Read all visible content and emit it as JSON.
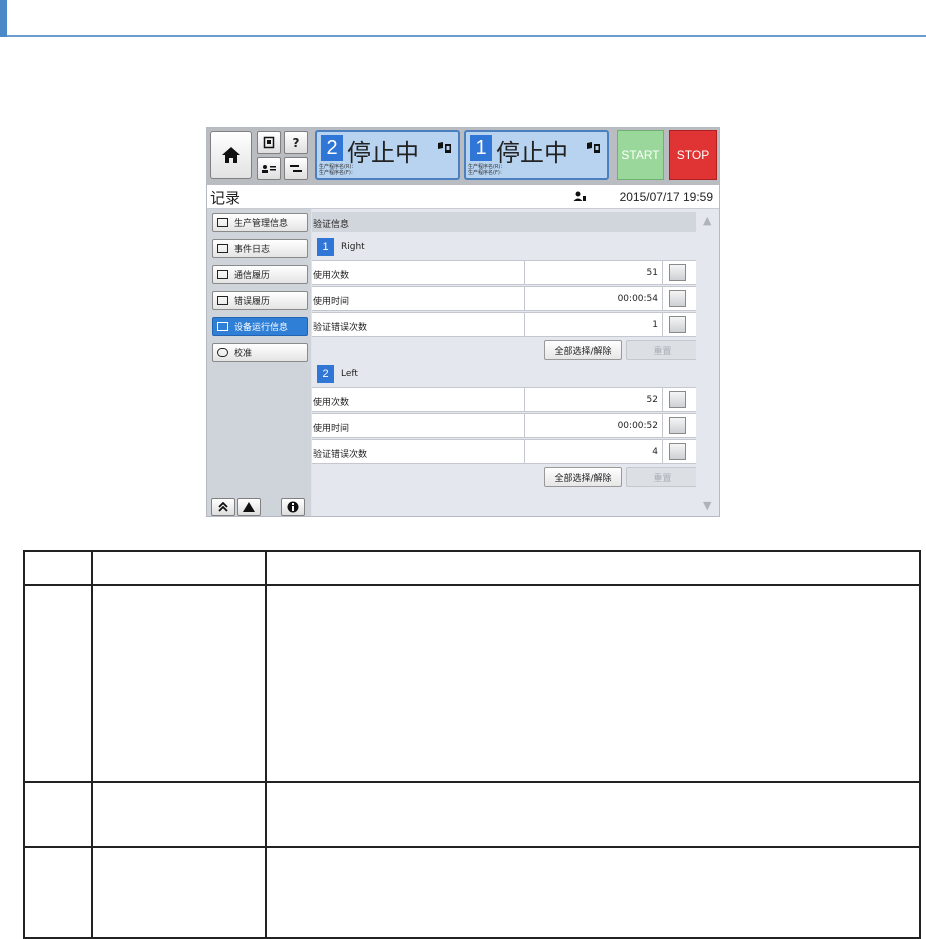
{
  "topbar": {
    "status_right": {
      "number": "2",
      "text": "停止中",
      "sub1": "生产程序名(R)：",
      "sub2": "生产程序名(F)："
    },
    "status_left": {
      "number": "1",
      "text": "停止中",
      "sub1": "生产程序名(R)：",
      "sub2": "生产程序名(F)："
    },
    "start_label": "START",
    "stop_label": "STOP",
    "help_label": "?"
  },
  "titlebar": {
    "title": "记录",
    "datetime": "2015/07/17 19:59"
  },
  "sidebar": {
    "items": [
      {
        "label": "生产管理信息",
        "active": false
      },
      {
        "label": "事件日志",
        "active": false
      },
      {
        "label": "通信履历",
        "active": false
      },
      {
        "label": "错误履历",
        "active": false
      },
      {
        "label": "设备运行信息",
        "active": true
      },
      {
        "label": "校准",
        "active": false
      }
    ]
  },
  "content": {
    "section_title": "验证信息",
    "groups": [
      {
        "number": "1",
        "name": "Right",
        "rows": [
          {
            "label": "使用次数",
            "value": "51"
          },
          {
            "label": "使用时间",
            "value": "00:00:54"
          },
          {
            "label": "验证错误次数",
            "value": "1"
          }
        ],
        "select_all_label": "全部选择/解除",
        "reset_label": "重置"
      },
      {
        "number": "2",
        "name": "Left",
        "rows": [
          {
            "label": "使用次数",
            "value": "52"
          },
          {
            "label": "使用时间",
            "value": "00:00:52"
          },
          {
            "label": "验证错误次数",
            "value": "4"
          }
        ],
        "select_all_label": "全部选择/解除",
        "reset_label": "重置"
      }
    ]
  },
  "colors": {
    "accent_blue": "#2f76d6",
    "start_green": "#9ad79a",
    "stop_red": "#e03434",
    "status_bg": "#b7d3ef"
  }
}
